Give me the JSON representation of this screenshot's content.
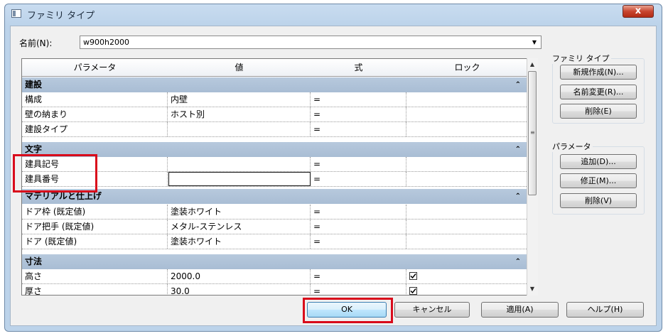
{
  "window": {
    "title": "ファミリ タイプ",
    "close_label": "x"
  },
  "name_field": {
    "label": "名前(N):",
    "value": "w900h2000"
  },
  "grid": {
    "headers": [
      "パラメータ",
      "値",
      "式",
      "ロック"
    ],
    "groups": [
      {
        "title": "建設",
        "rows": [
          {
            "param": "構成",
            "value": "内壁",
            "formula": "="
          },
          {
            "param": "壁の納まり",
            "value": "ホスト別",
            "formula": "="
          },
          {
            "param": "建設タイプ",
            "value": "",
            "formula": "="
          }
        ]
      },
      {
        "title": "文字",
        "rows": [
          {
            "param": "建具記号",
            "value": "",
            "formula": "="
          },
          {
            "param": "建具番号",
            "value": "",
            "formula": "="
          }
        ]
      },
      {
        "title": "マテリアルと仕上げ",
        "rows": [
          {
            "param": "ドア枠 (既定値)",
            "value": "塗装ホワイト",
            "formula": "="
          },
          {
            "param": "ドア把手 (既定値)",
            "value": "メタル-ステンレス",
            "formula": "="
          },
          {
            "param": "ドア (既定値)",
            "value": "塗装ホワイト",
            "formula": "="
          }
        ]
      },
      {
        "title": "寸法",
        "rows": [
          {
            "param": "高さ",
            "value": "2000.0",
            "formula": "=",
            "locked": true
          },
          {
            "param": "厚さ",
            "value": "30.0",
            "formula": "=",
            "locked": true
          }
        ]
      }
    ]
  },
  "family_types_group": {
    "label": "ファミリ タイプ",
    "buttons": [
      "新規作成(N)...",
      "名前変更(R)...",
      "削除(E)"
    ]
  },
  "parameters_group": {
    "label": "パラメータ",
    "buttons": [
      "追加(D)...",
      "修正(M)...",
      "削除(V)"
    ]
  },
  "footer": {
    "ok": "OK",
    "cancel": "キャンセル",
    "apply": "適用(A)",
    "help": "ヘルプ(H)"
  },
  "colors": {
    "highlight": "#d90b1b",
    "group_header": "#b0c4da",
    "title_close": "#c8452f"
  }
}
